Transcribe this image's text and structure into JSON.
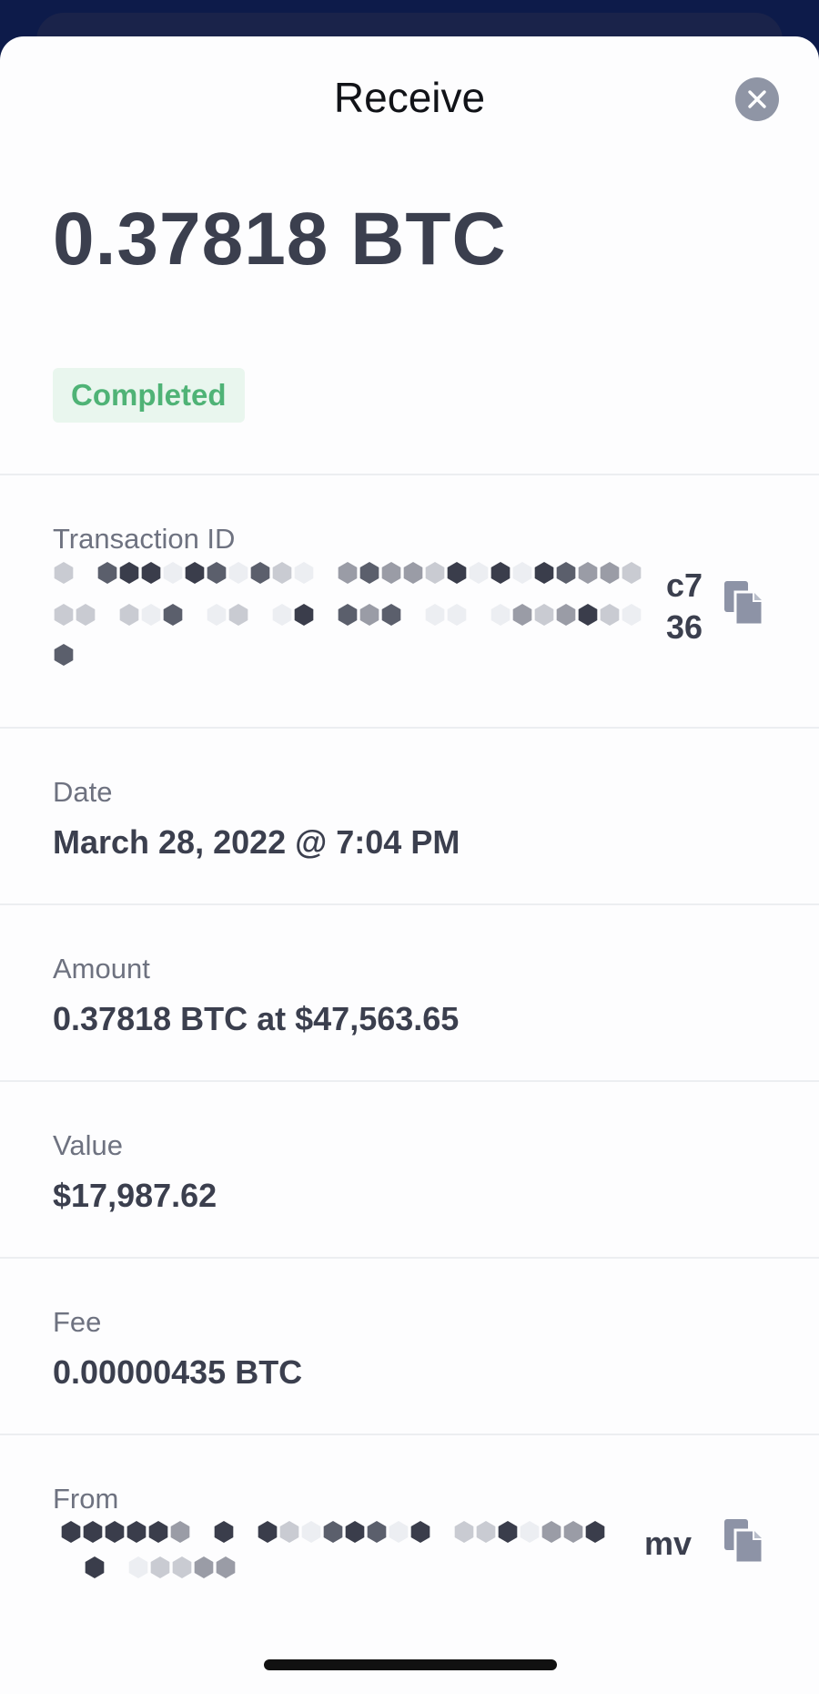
{
  "header": {
    "title": "Receive"
  },
  "amount": "0.37818 BTC",
  "status": "Completed",
  "fields": {
    "transaction_id": {
      "label": "Transaction ID",
      "tail_line1": "c7",
      "tail_line2": "36"
    },
    "date": {
      "label": "Date",
      "value": "March 28, 2022 @ 7:04 PM"
    },
    "amount": {
      "label": "Amount",
      "value": "0.37818 BTC at $47,563.65"
    },
    "value": {
      "label": "Value",
      "value": "$17,987.62"
    },
    "fee": {
      "label": "Fee",
      "value": "0.00000435 BTC"
    },
    "from": {
      "label": "From",
      "tail_line1": "mv"
    }
  },
  "colors": {
    "accent": "#4fb376",
    "badge_bg": "#e9f6ee",
    "text_dark": "#3b3f4e",
    "text_muted": "#6e7280"
  },
  "icons": {
    "close": "close-icon",
    "copy": "copy-icon"
  }
}
